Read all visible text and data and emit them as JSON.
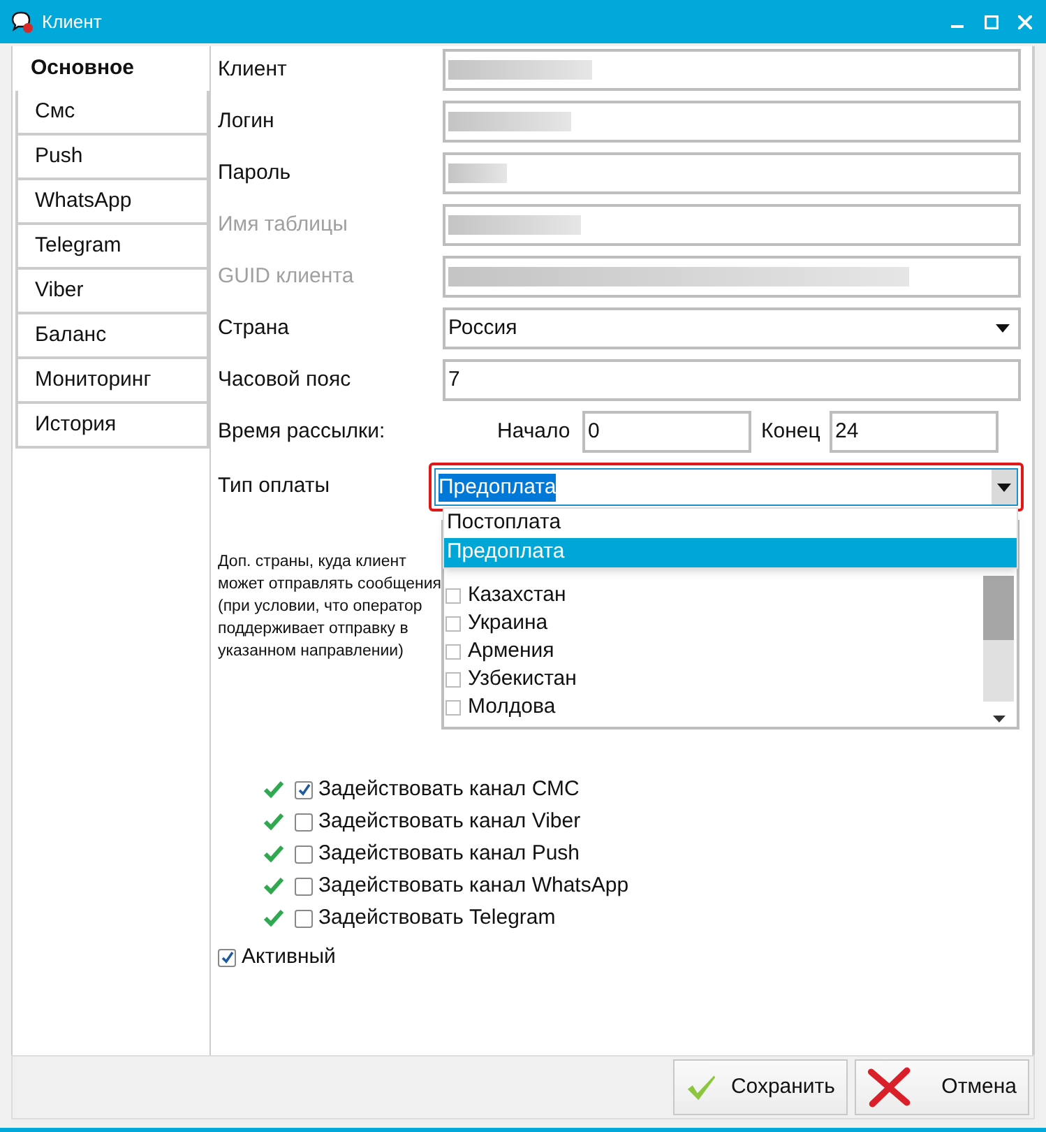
{
  "window": {
    "title": "Клиент"
  },
  "tabs": [
    {
      "label": "Основное",
      "selected": true
    },
    {
      "label": "Смс",
      "selected": false
    },
    {
      "label": "Push",
      "selected": false
    },
    {
      "label": "WhatsApp",
      "selected": false
    },
    {
      "label": "Telegram",
      "selected": false
    },
    {
      "label": "Viber",
      "selected": false
    },
    {
      "label": "Баланс",
      "selected": false
    },
    {
      "label": "Мониторинг",
      "selected": false
    },
    {
      "label": "История",
      "selected": false
    }
  ],
  "fields": [
    {
      "label": "Клиент",
      "kind": "redacted",
      "disabled": false
    },
    {
      "label": "Логин",
      "kind": "redacted",
      "disabled": false
    },
    {
      "label": "Пароль",
      "kind": "redacted",
      "disabled": false
    },
    {
      "label": "Имя таблицы",
      "kind": "redacted",
      "disabled": true
    },
    {
      "label": "GUID клиента",
      "kind": "redacted",
      "disabled": true
    },
    {
      "label": "Страна",
      "kind": "select",
      "value": "Россия",
      "disabled": false
    },
    {
      "label": "Часовой пояс",
      "kind": "text",
      "value": "7",
      "disabled": false
    }
  ],
  "send_time": {
    "label": "Время рассылки:",
    "start_label": "Начало",
    "start": "0",
    "end_label": "Конец",
    "end": "24"
  },
  "payment_type": {
    "label": "Тип оплаты",
    "value": "Предоплата",
    "expanded": true,
    "options": [
      {
        "label": "Постоплата",
        "selected": false
      },
      {
        "label": "Предоплата",
        "selected": true
      }
    ]
  },
  "extra_countries": {
    "description": "Доп. страны, куда клиент может отправлять сообщения (при условии, что оператор поддерживает отправку в указанном направлении)",
    "items": [
      {
        "label": "Казахстан",
        "checked": false
      },
      {
        "label": "Украина",
        "checked": false
      },
      {
        "label": "Армения",
        "checked": false
      },
      {
        "label": "Узбекистан",
        "checked": false
      },
      {
        "label": "Молдова",
        "checked": false
      }
    ]
  },
  "channels": [
    {
      "label": "Задействовать канал СМС",
      "checked": true
    },
    {
      "label": "Задействовать канал Viber",
      "checked": false
    },
    {
      "label": "Задействовать канал Push",
      "checked": false
    },
    {
      "label": "Задействовать канал WhatsApp",
      "checked": false
    },
    {
      "label": "Задействовать Telegram",
      "checked": false
    }
  ],
  "active": {
    "label": "Активный",
    "checked": true
  },
  "buttons": [
    {
      "label": "Сохранить",
      "kind": "save"
    },
    {
      "label": "Отмена",
      "kind": "cancel"
    }
  ]
}
